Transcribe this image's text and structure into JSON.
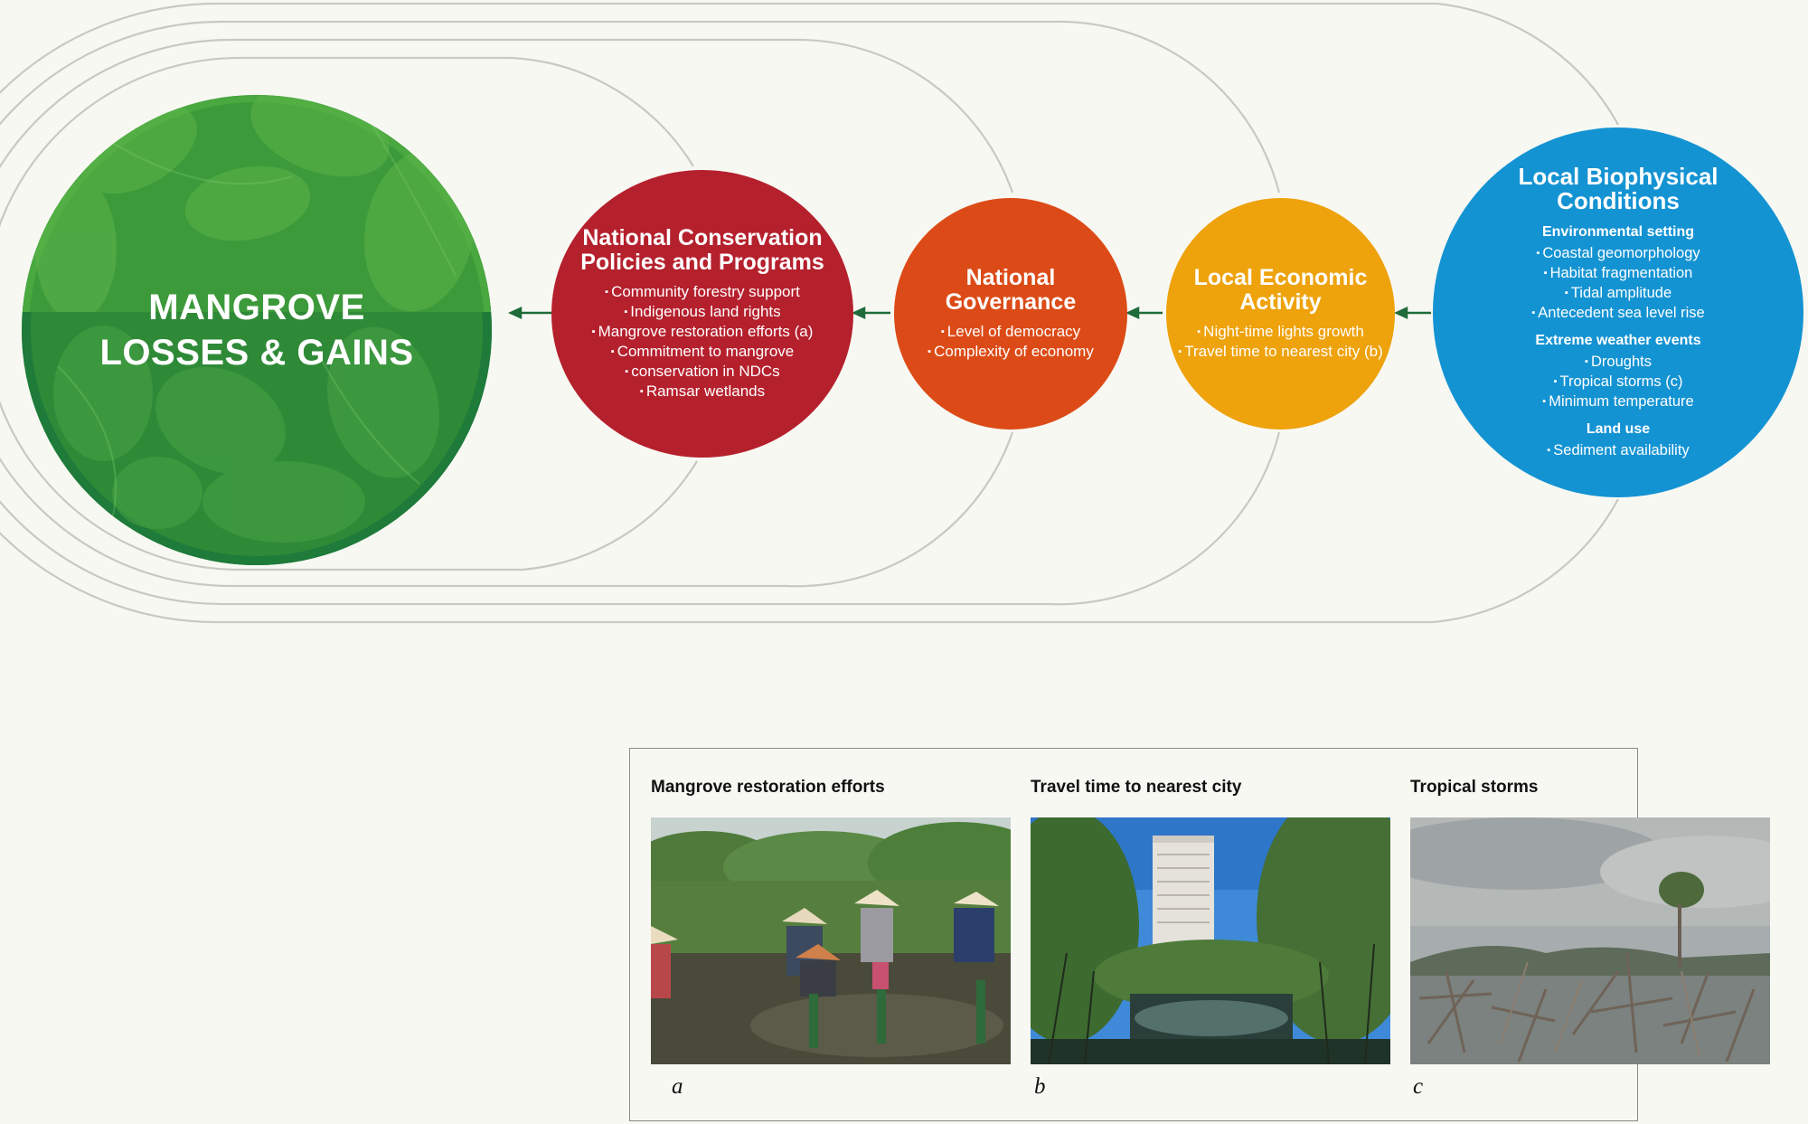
{
  "nodes": {
    "mangrove": {
      "title_line1": "MANGROVE",
      "title_line2": "LOSSES & GAINS",
      "color": "#2e8b3a"
    },
    "policies": {
      "title_line1": "National Conservation",
      "title_line2": "Policies and Programs",
      "color": "#b5202d",
      "items": [
        "Community forestry support",
        "Indigenous land rights",
        "Mangrove restoration efforts (a)",
        "Commitment to mangrove",
        "conservation in NDCs",
        "Ramsar wetlands"
      ]
    },
    "governance": {
      "title_line1": "National",
      "title_line2": "Governance",
      "color": "#dc4b17",
      "items": [
        "Level of democracy",
        "Complexity of economy"
      ]
    },
    "economic": {
      "title_line1": "Local Economic",
      "title_line2": "Activity",
      "color": "#eea20c",
      "items": [
        "Night-time lights growth",
        "Travel time to nearest city (b)"
      ]
    },
    "biophysical": {
      "title_line1": "Local Biophysical",
      "title_line2": "Conditions",
      "color": "#1493d3",
      "groups": [
        {
          "heading": "Environmental setting",
          "items": [
            "Coastal geomorphology",
            "Habitat fragmentation",
            "Tidal amplitude",
            "Antecedent sea level rise"
          ]
        },
        {
          "heading": "Extreme weather events",
          "items": [
            "Droughts",
            "Tropical storms (c)",
            "Minimum temperature"
          ]
        },
        {
          "heading": "Land use",
          "items": [
            "Sediment availability"
          ]
        }
      ]
    }
  },
  "photos": [
    {
      "title": "Mangrove restoration efforts",
      "letter": "a",
      "image": "people-planting-mangroves-photo"
    },
    {
      "title": "Travel time to nearest city",
      "letter": "b",
      "image": "mangroves-with-tower-block-photo"
    },
    {
      "title": "Tropical storms",
      "letter": "c",
      "image": "storm-damaged-mangroves-photo"
    }
  ],
  "colors": {
    "arrow": "#1f6b3a",
    "loop_lines": "#c8c8c4",
    "background": "#f8f8f3"
  }
}
